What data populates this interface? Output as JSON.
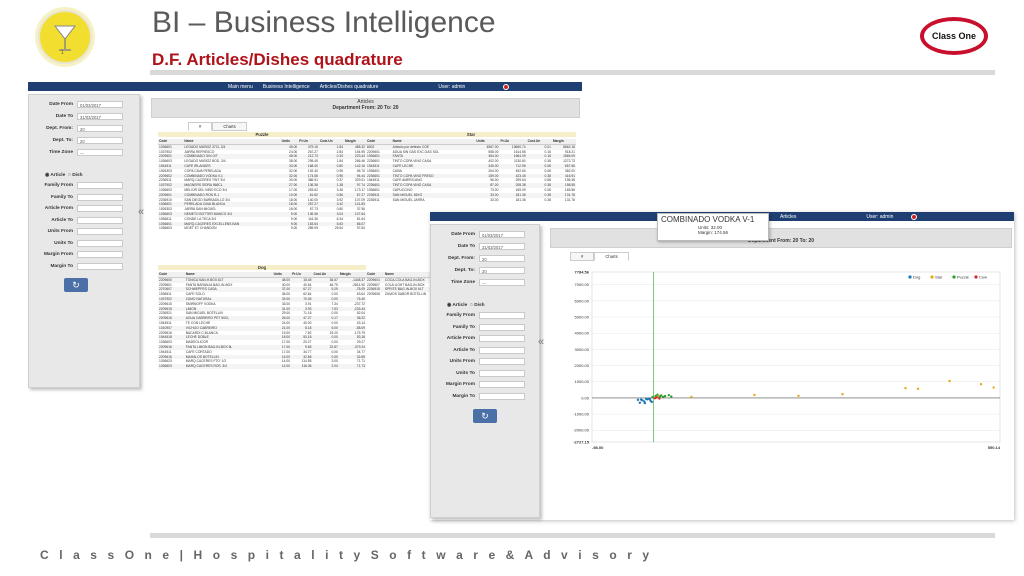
{
  "slide": {
    "title": "BI – Business Intelligence",
    "subtitle": "D.F. Articles/Dishes quadrature",
    "brand": "Class One",
    "logo_number": "1",
    "footer": "C l a s s O n e | H o s p i t a l i t y S o f t w a r e & A d v i s o r y",
    "colors": {
      "title": "#5a5a5a",
      "subtitle": "#b0121a",
      "nav": "#1f3f73",
      "brand_ring": "#c8102e",
      "logo": "#f2de2e"
    }
  },
  "nav": {
    "main_menu": "Main menu",
    "breadcrumb": "Business Intelligence",
    "page": "Articles/Dishes quadrature",
    "user": "User: admin"
  },
  "filters": [
    {
      "label": "Date From",
      "value": "01/03/2017"
    },
    {
      "label": "Date To",
      "value": "31/03/2017"
    },
    {
      "label": "Dept. From:",
      "value": "20"
    },
    {
      "label": "Dept. To:",
      "value": "20"
    },
    {
      "label": "Time Zone",
      "value": "---"
    }
  ],
  "filters2": [
    {
      "label": "Date From",
      "value": "01/03/2017"
    },
    {
      "label": "Date To",
      "value": "31/03/2017"
    },
    {
      "label": "Dept. From:",
      "value": "20"
    },
    {
      "label": "Dept. To:",
      "value": "20"
    },
    {
      "label": "Time Zone",
      "value": "---"
    }
  ],
  "radio": {
    "article": "Article",
    "dish": "Dish"
  },
  "range_fields": [
    "Family From",
    "Family To",
    "Article From",
    "Article To",
    "Units From",
    "Units To",
    "Margin From",
    "Margin To"
  ],
  "refresh_icon": "↻",
  "collapse_icon": "«",
  "report": {
    "title": "Articles",
    "subtitle": "Department From: 20 To: 20",
    "tab_grid": "#",
    "tab_charts": "Charts"
  },
  "report2": {
    "page": "Articles",
    "subtitle": "Department From: 20 To: 20",
    "tab_grid": "#",
    "tab_charts": "Charts"
  },
  "columns": [
    "Code",
    "Name",
    "Units",
    "Pr.Un",
    "Cost.Un",
    "Margin"
  ],
  "columns_short": [
    "Code",
    "Name"
  ],
  "groups": {
    "puzzle": "Puzzle",
    "star": "Star",
    "dog": "Dog"
  },
  "puzzle_rows": [
    [
      "1036601",
      "LEGADO MUÑOZ 37CL 3/4",
      "45.00",
      "379.15",
      "1.84",
      "485.32"
    ],
    [
      "1037902",
      "JARRA REFRESCO",
      "24.00",
      "267.27",
      "2.84",
      "154.95"
    ],
    [
      "2209601",
      "COMBINADO GIN G/T",
      "48.00",
      "212.73",
      "0.33",
      "223.44"
    ],
    [
      "1036603",
      "LEGADO MUÑOZ BOD. 3/4",
      "38.00",
      "295.45",
      "1.84",
      "266.46"
    ],
    [
      "1944511",
      "CAFE IRLANDES",
      "33.00",
      "168.40",
      "0.80",
      "142.16"
    ],
    [
      "1926303",
      "COPA CAVA PERELADA",
      "32.00",
      "192.40",
      "0.95",
      "96.70"
    ],
    [
      "2209602",
      "COMBINADO VODKA V-1",
      "32.00",
      "174.56",
      "0.95",
      "94.44"
    ],
    [
      "2236911",
      "MARQ.CACERES TINT 3/4",
      "30.00",
      "386.91",
      "0.37",
      "329.01"
    ],
    [
      "1037902",
      "MAGNERS SIDRA 568CL",
      "27.00",
      "136.36",
      "1.38",
      "97.74"
    ],
    [
      "1036603",
      "MELIOR DEL NIÑO ECO 3/4",
      "17.00",
      "253.62",
      "3.45",
      "173.17"
    ],
    [
      "2209601",
      "COMBINADO RON R-1",
      "10.00",
      "61.82",
      "0.56",
      "67.27"
    ],
    [
      "2236910",
      "SAN DIEGO BARBADILLO 3/4",
      "18.00",
      "140.00",
      "3.92",
      "107.09"
    ],
    [
      "1036601",
      "PERELADA CAVA BLANCA",
      "18.00",
      "257.27",
      "3.42",
      "141.83"
    ],
    [
      "1926303",
      "JARRA SAN MIGUEL",
      "18.00",
      "57.73",
      "0.80",
      "37.96"
    ],
    [
      "1036603",
      "NEMETO BOTTER BIANCO 3/4",
      "9.00",
      "136.36",
      "3.04",
      "107.64"
    ],
    [
      "1936611",
      "CONDE LA TECA 3/4",
      "9.00",
      "116.36",
      "6.34",
      "81.64"
    ],
    [
      "1036601",
      "MARQ.CACERES EXCELLENS BAN",
      "9.00",
      "163.64",
      "5.63",
      "86.07"
    ],
    [
      "1036603",
      "MOET ET CHANDON",
      "9.00",
      "289.09",
      "25.54",
      "97.84"
    ]
  ],
  "star_rows": [
    [
      "8002",
      "Articulo por defecto COE",
      "4567.00",
      "13660.74",
      "0.01",
      "8662.16"
    ],
    [
      "2209601",
      "AGUA SIN GAS EXC.GAS SOL",
      "558.00",
      "1614.55",
      "0.16",
      "918.21"
    ],
    [
      "1936601",
      "FANTA",
      "454.00",
      "1664.09",
      "0.18",
      "1565.09"
    ],
    [
      "2236601",
      "TINTO COPA VINO CASA",
      "402.00",
      "1130.60",
      "0.38",
      "1272.73"
    ],
    [
      "1944511",
      "CAFE LECHE",
      "345.00",
      "712.95",
      "0.08",
      "657.56"
    ],
    [
      "1936601",
      "CAÑA",
      "264.00",
      "492.60",
      "0.08",
      "382.00"
    ],
    [
      "2236601",
      "TINTO COPA VINO FRESO",
      "159.00",
      "423.45",
      "0.38",
      "416.91"
    ],
    [
      "1944511",
      "CAFE AMERICANO",
      "96.00",
      "299.64",
      "0.88",
      "196.36"
    ],
    [
      "2236601",
      "TINTO COPA VINO CASA",
      "87.00",
      "208.38",
      "0.38",
      "158.55"
    ],
    [
      "1936601",
      "CAPUCCINO",
      "73.00",
      "169.09",
      "0.08",
      "165.56"
    ],
    [
      "2236911",
      "SAN MIGUEL MIXO",
      "33.00",
      "181.36",
      "0.38",
      "131.76"
    ],
    [
      "2236911",
      "SAN MIGUEL JARRA",
      "33.00",
      "181.36",
      "0.38",
      "131.76"
    ]
  ],
  "dog_rows": [
    [
      "2209600",
      "TONICA SAN-H.BOX.6LT",
      "48.00",
      "15.45",
      "36.57",
      "-1448.37"
    ],
    [
      "2209601",
      "FANTA NARANJA BAG-IN-BOX",
      "40.00",
      "40.64",
      "46.75",
      "-2814.90"
    ],
    [
      "2270607",
      "SCHWEPPES CASA",
      "37.00",
      "67.27",
      "9.29",
      "-78.09"
    ],
    [
      "1936611",
      "CAFE SOLO",
      "36.00",
      "62.64",
      "0.00",
      "63.64"
    ],
    [
      "1037902",
      "ZUMO NATURAL",
      "33.00",
      "70.45",
      "0.00",
      "76.40"
    ],
    [
      "2209615",
      "SMIRNOFF VODKA",
      "33.00",
      "3.91",
      "7.34",
      "-237.72"
    ],
    [
      "2209615",
      "LIMON",
      "31.00",
      "3.93",
      "7.53",
      "-233.43"
    ],
    [
      "2236921",
      "SAN MIGUEL BOTELLIN",
      "29.00",
      "71.18",
      "0.00",
      "52.04"
    ],
    [
      "2209616",
      "AGUA CABREIRO PET 50CL",
      "26.00",
      "47.27",
      "0.17",
      "36.22"
    ],
    [
      "1944511",
      "TE CON LECHE",
      "24.00",
      "40.00",
      "0.00",
      "43.14"
    ],
    [
      "1010907",
      "VICHIJO CABREIRO",
      "21.00",
      "8.18",
      "6.00",
      "-58.09"
    ],
    [
      "2209616",
      "BACARDI C.BLANCA",
      "19.00",
      "7.82",
      "19.20",
      "-175.79"
    ],
    [
      "1944518",
      "LECHE DOBLE",
      "18.00",
      "53.18",
      "0.00",
      "53.18"
    ],
    [
      "1036603",
      "MADEOLICOR",
      "17.00",
      "20.27",
      "0.00",
      "29.27"
    ],
    [
      "2209616",
      "FANTA LIMON BAG-IN-BOX 6L",
      "17.00",
      "9.65",
      "22.87",
      "-379.24"
    ],
    [
      "1944511",
      "CAFE CORTADO",
      "17.00",
      "34.77",
      "0.00",
      "34.77"
    ],
    [
      "2209616",
      "MAHALOS BOTELLIN",
      "16.00",
      "32.65",
      "0.00",
      "32.65"
    ],
    [
      "1036623",
      "MARQ.CACERES FTO' 1/2",
      "14.00",
      "114.55",
      "3.00",
      "71.71"
    ],
    [
      "1036603",
      "MARQ.CACERES ROS. 3/4",
      "14.00",
      "116.36",
      "2.04",
      "71.73"
    ]
  ],
  "dog_rows_right": [
    [
      "2209603",
      "COCA-COLA BAG-IN-BOX"
    ],
    [
      "2209607",
      "COLA LIGHT BAG-IN-BOX"
    ],
    [
      "2236915",
      "SPRITE BAG-IN-BOX 6LT"
    ],
    [
      "2209608",
      "ZUMOS SABOR BOTELLIN"
    ]
  ],
  "tooltip": {
    "name": "COMBINADO VODKA V-1",
    "units": "Units: 32.00",
    "margin": "Margin: 174.56"
  },
  "chart_data": {
    "type": "scatter",
    "title": "",
    "xlabel": "",
    "ylabel": "",
    "xlim": [
      -98.0,
      550.14
    ],
    "ylim": [
      -2727.15,
      7784.56
    ],
    "x_tick_labels": [
      "-98.00",
      "550.14"
    ],
    "y_tick_labels": [
      "7784.56",
      "7000.00",
      "6000.00",
      "5000.00",
      "4000.00",
      "3000.00",
      "2000.00",
      "1000.00",
      "0.00",
      "-1000.00",
      "-2000.00",
      "-2727.15"
    ],
    "legend": "top-right",
    "series": [
      {
        "name": "Dog",
        "color": "#1f77b4",
        "points": [
          [
            -20,
            -100
          ],
          [
            -15,
            -220
          ],
          [
            -10,
            -90
          ],
          [
            -5,
            -180
          ],
          [
            -22,
            -300
          ],
          [
            -12,
            -60
          ],
          [
            -8,
            -40
          ],
          [
            -18,
            -150
          ],
          [
            -3,
            -250
          ],
          [
            -25,
            -120
          ],
          [
            -14,
            -320
          ],
          [
            -6,
            -80
          ]
        ]
      },
      {
        "name": "Star",
        "color": "#e6a817",
        "points": [
          [
            160,
            180
          ],
          [
            230,
            130
          ],
          [
            300,
            230
          ],
          [
            420,
            560
          ],
          [
            400,
            600
          ],
          [
            470,
            1050
          ],
          [
            520,
            850
          ],
          [
            540,
            640
          ],
          [
            8,
            100
          ],
          [
            60,
            60
          ]
        ]
      },
      {
        "name": "Puzzle",
        "color": "#2ca02c",
        "points": [
          [
            -2,
            40
          ],
          [
            3,
            120
          ],
          [
            6,
            200
          ],
          [
            10,
            90
          ],
          [
            12,
            150
          ],
          [
            15,
            60
          ],
          [
            18,
            110
          ],
          [
            24,
            170
          ],
          [
            28,
            80
          ]
        ]
      },
      {
        "name": "Cow",
        "color": "#d62728",
        "points": [
          [
            2,
            -20
          ],
          [
            5,
            30
          ],
          [
            9,
            -40
          ]
        ]
      }
    ]
  }
}
